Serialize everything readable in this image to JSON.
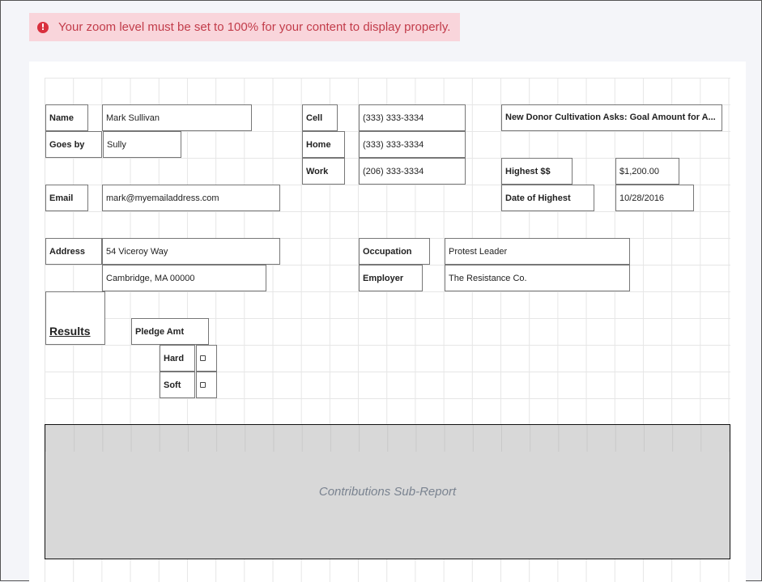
{
  "alert": {
    "icon": "exclamation-circle-icon",
    "text": "Your zoom level must be set to 100% for your content to display properly.",
    "color": "#c23c4a",
    "background": "#f9d5db"
  },
  "contact": {
    "name_label": "Name",
    "name_value": "Mark Sullivan",
    "goes_by_label": "Goes by",
    "goes_by_value": "Sully",
    "email_label": "Email",
    "email_value": "mark@myemailaddress.com",
    "address_label": "Address",
    "address_line1": "54 Viceroy Way",
    "address_line2": "Cambridge, MA 00000"
  },
  "phones": {
    "cell_label": "Cell",
    "cell_value": "(333) 333-3334",
    "home_label": "Home",
    "home_value": "(333) 333-3334",
    "work_label": "Work",
    "work_value": "(206) 333-3334"
  },
  "giving": {
    "cultivation_label": "New Donor Cultivation Asks: Goal Amount for A...",
    "highest_label": "Highest $$",
    "highest_value": "$1,200.00",
    "date_label": "Date of Highest",
    "date_value": "10/28/2016"
  },
  "work_info": {
    "occupation_label": "Occupation",
    "occupation_value": "Protest Leader",
    "employer_label": "Employer",
    "employer_value": "The Resistance Co."
  },
  "results": {
    "title": "Results",
    "pledge_label": "Pledge Amt",
    "hard_label": "Hard",
    "soft_label": "Soft",
    "hard_checked": false,
    "soft_checked": false
  },
  "subreport": {
    "label": "Contributions Sub-Report"
  }
}
